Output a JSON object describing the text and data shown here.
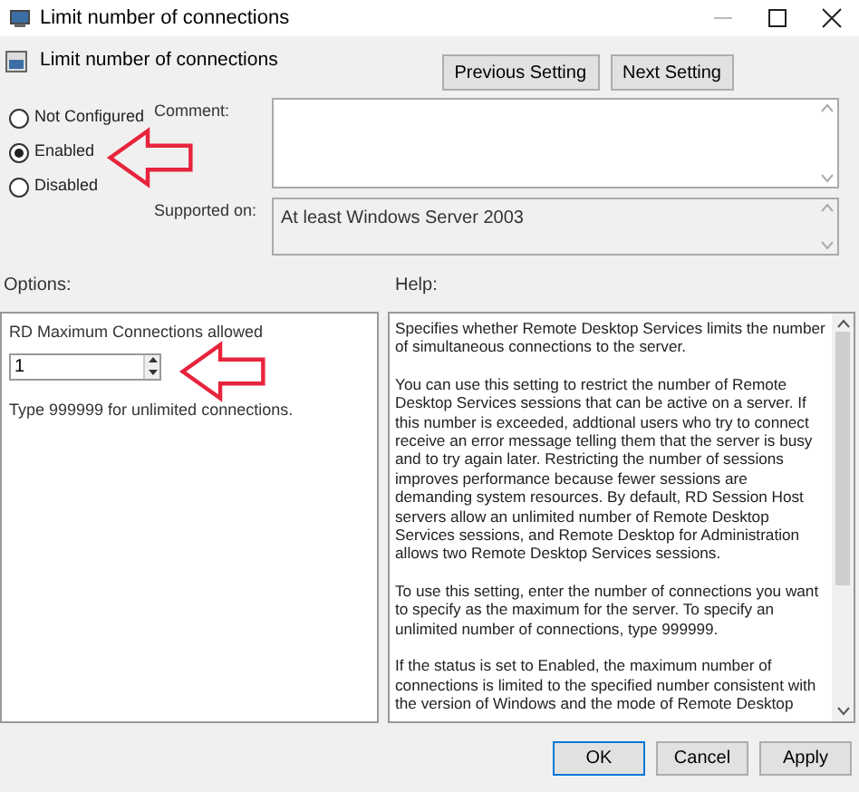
{
  "window": {
    "title": "Limit number of connections"
  },
  "header": {
    "title": "Limit number of connections"
  },
  "nav_buttons": [
    {
      "label": "Previous Setting"
    },
    {
      "label": "Next Setting"
    }
  ],
  "state_options": [
    {
      "label": "Not Configured",
      "selected": false
    },
    {
      "label": "Enabled",
      "selected": true
    },
    {
      "label": "Disabled",
      "selected": false
    }
  ],
  "comment": {
    "label": "Comment:"
  },
  "supported_on": {
    "label": "Supported on:",
    "value": "At least Windows Server 2003"
  },
  "options": {
    "label": "Options:",
    "field_label": "RD Maximum Connections allowed",
    "value": "1",
    "hint": "Type 999999 for unlimited connections."
  },
  "help": {
    "label": "Help:",
    "paragraphs": [
      "Specifies whether Remote Desktop Services limits the number of simultaneous connections to the server.",
      "You can use this setting to restrict the number of Remote Desktop Services sessions that can be active on a server. If this number is exceeded, addtional users who try to connect receive an error message telling them that the server is busy and to try again later. Restricting the number of sessions improves performance because fewer sessions are demanding system resources. By default, RD Session Host servers allow an unlimited number of Remote Desktop Services sessions, and Remote Desktop for Administration allows two Remote Desktop Services sessions.",
      "To use this setting, enter the number of connections you want to specify as the maximum for the server. To specify an unlimited number of connections, type 999999.",
      "If the status is set to Enabled, the maximum number of connections is limited to the specified number consistent with the version of Windows and the mode of Remote Desktop"
    ]
  },
  "buttons": [
    {
      "label": "OK",
      "selected": true
    },
    {
      "label": "Cancel",
      "selected": false
    },
    {
      "label": "Apply",
      "selected": false
    }
  ]
}
